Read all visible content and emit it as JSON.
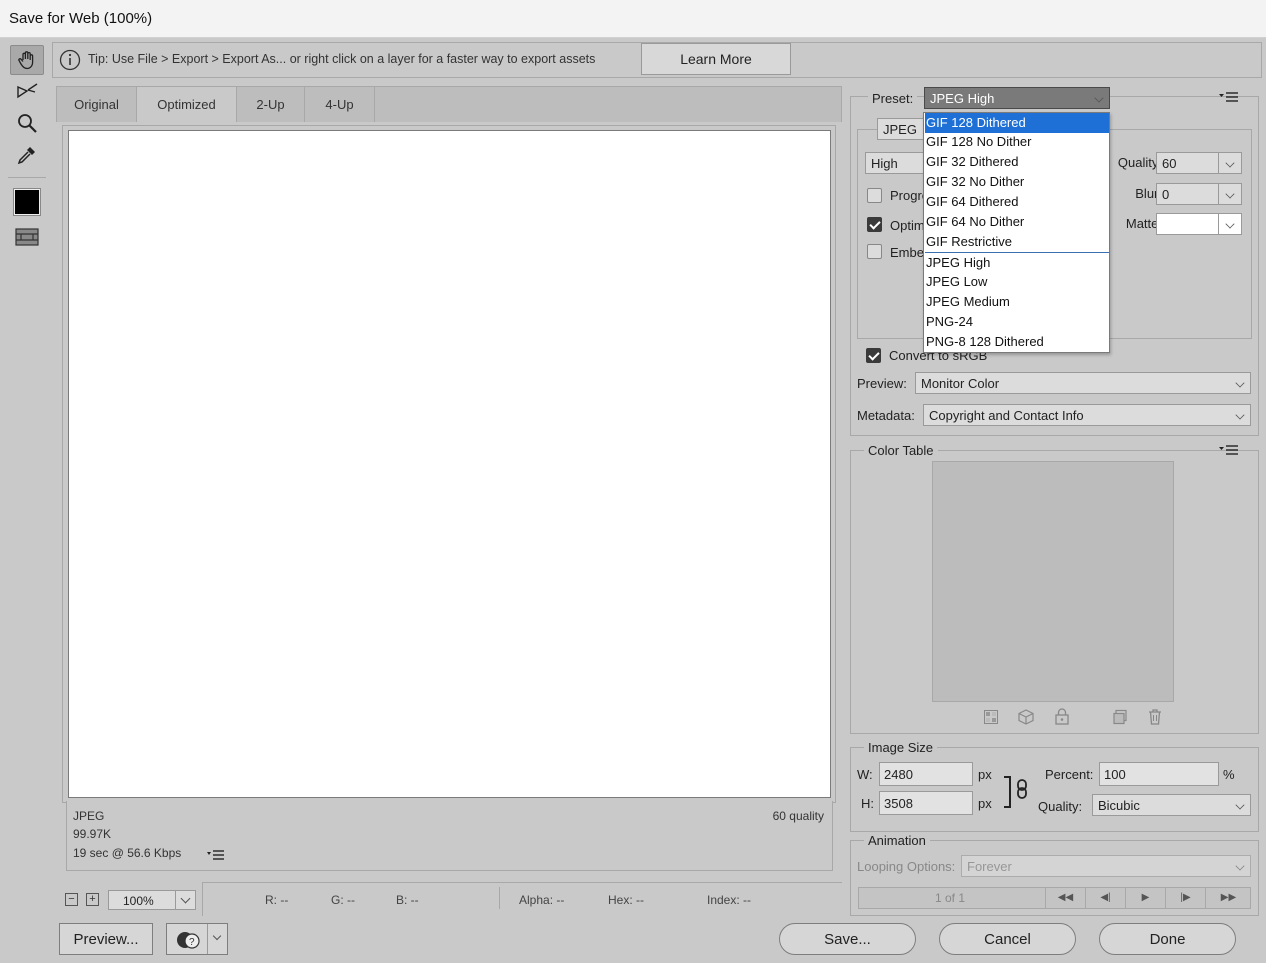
{
  "window": {
    "title": "Save for Web (100%)"
  },
  "tip": {
    "text": "Tip: Use File > Export > Export As...  or right click on a layer for a faster way to export assets",
    "learn_more": "Learn More"
  },
  "tools": [
    "hand-tool",
    "slice-select-tool",
    "zoom-tool",
    "eyedropper-tool",
    "eyedropper-color",
    "toggle-slices"
  ],
  "view_tabs": [
    "Original",
    "Optimized",
    "2-Up",
    "4-Up"
  ],
  "image_info": {
    "format": "JPEG",
    "size": "99.97K",
    "download": "19 sec @ 56.6 Kbps",
    "quality": "60 quality"
  },
  "zoom": {
    "value": "100%",
    "minus": "−",
    "plus": "+"
  },
  "readout": {
    "r": "R: --",
    "g": "G: --",
    "b": "B: --",
    "alpha": "Alpha: --",
    "hex": "Hex: --",
    "index": "Index: --"
  },
  "bottom_buttons": {
    "preview": "Preview...",
    "save": "Save...",
    "cancel": "Cancel",
    "done": "Done"
  },
  "settings": {
    "preset_label": "Preset:",
    "preset_value": "JPEG High",
    "format": "JPEG",
    "quality_name": "High",
    "progressive": "Progressive",
    "optimized": "Optimized",
    "embed": "Embed Color Profile",
    "quality_label": "Quality:",
    "quality_value": "60",
    "blur_label": "Blur:",
    "blur_value": "0",
    "matte_label": "Matte:",
    "convert_srgb": "Convert to sRGB",
    "preview_label": "Preview:",
    "preview_value": "Monitor Color",
    "metadata_label": "Metadata:",
    "metadata_value": "Copyright and Contact Info"
  },
  "preset_options": {
    "gif": [
      "GIF 128 Dithered",
      "GIF 128 No Dither",
      "GIF 32 Dithered",
      "GIF 32 No Dither",
      "GIF 64 Dithered",
      "GIF 64 No Dither",
      "GIF Restrictive"
    ],
    "other": [
      "JPEG High",
      "JPEG Low",
      "JPEG Medium",
      "PNG-24",
      "PNG-8 128 Dithered"
    ],
    "highlighted": "GIF 128 Dithered"
  },
  "color_table": {
    "title": "Color Table"
  },
  "image_size": {
    "title": "Image Size",
    "w_label": "W:",
    "w_value": "2480",
    "h_label": "H:",
    "h_value": "3508",
    "unit": "px",
    "percent_label": "Percent:",
    "percent_value": "100",
    "percent_unit": "%",
    "quality_label": "Quality:",
    "quality_value": "Bicubic"
  },
  "animation": {
    "title": "Animation",
    "looping_label": "Looping Options:",
    "looping_value": "Forever",
    "frame": "1 of 1"
  }
}
